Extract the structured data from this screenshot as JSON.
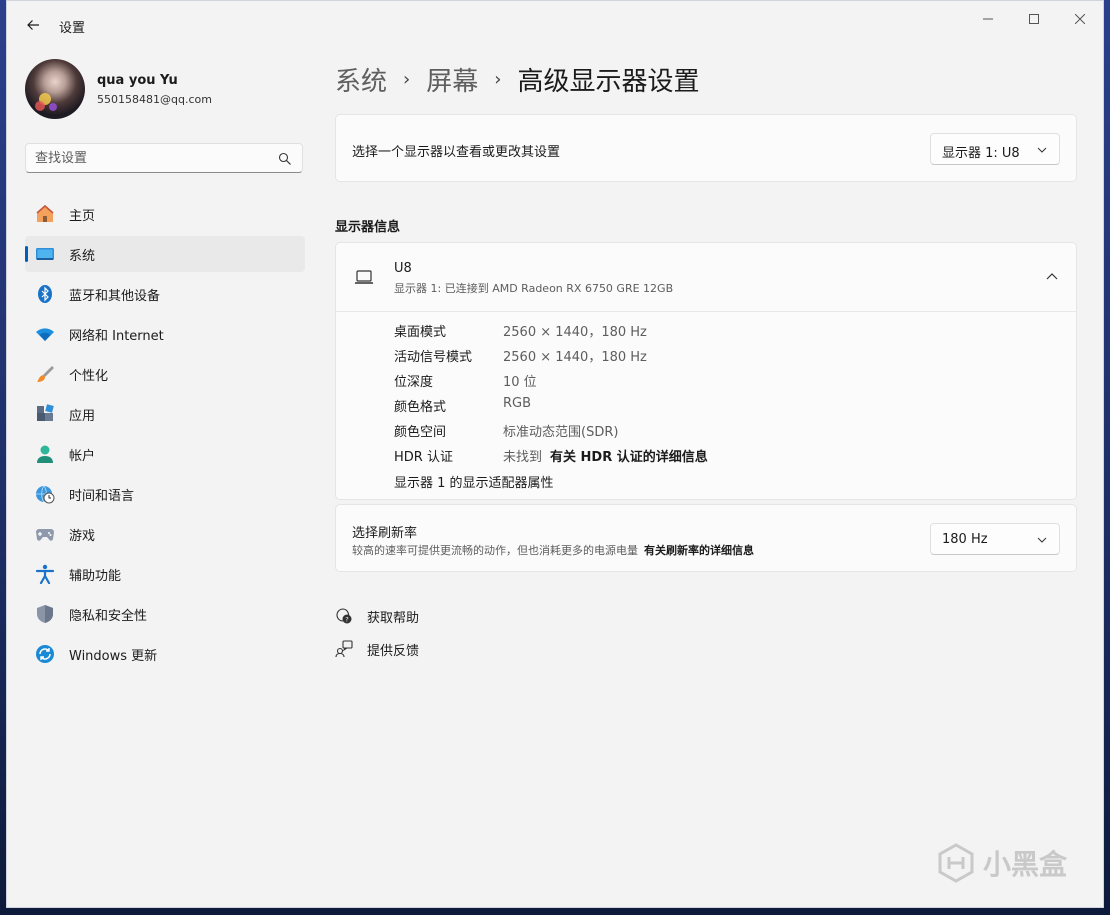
{
  "window": {
    "title": "设置",
    "controls": {
      "minimize": "minimize-icon",
      "maximize": "maximize-icon",
      "close": "close-icon"
    }
  },
  "user": {
    "name": "qua you Yu",
    "email": "550158481@qq.com"
  },
  "search": {
    "placeholder": "查找设置"
  },
  "sidebar": {
    "items": [
      {
        "label": "主页",
        "icon": "home-icon",
        "selected": false
      },
      {
        "label": "系统",
        "icon": "system-icon",
        "selected": true
      },
      {
        "label": "蓝牙和其他设备",
        "icon": "bluetooth-icon",
        "selected": false
      },
      {
        "label": "网络和 Internet",
        "icon": "wifi-icon",
        "selected": false
      },
      {
        "label": "个性化",
        "icon": "brush-icon",
        "selected": false
      },
      {
        "label": "应用",
        "icon": "apps-icon",
        "selected": false
      },
      {
        "label": "帐户",
        "icon": "account-icon",
        "selected": false
      },
      {
        "label": "时间和语言",
        "icon": "globe-clock-icon",
        "selected": false
      },
      {
        "label": "游戏",
        "icon": "gamepad-icon",
        "selected": false
      },
      {
        "label": "辅助功能",
        "icon": "accessibility-icon",
        "selected": false
      },
      {
        "label": "隐私和安全性",
        "icon": "shield-icon",
        "selected": false
      },
      {
        "label": "Windows 更新",
        "icon": "update-icon",
        "selected": false
      }
    ]
  },
  "breadcrumb": {
    "items": [
      "系统",
      "屏幕",
      "高级显示器设置"
    ],
    "separator": "›"
  },
  "display_select": {
    "label": "选择一个显示器以查看或更改其设置",
    "value": "显示器 1: U8"
  },
  "display_info": {
    "section_title": "显示器信息",
    "name": "U8",
    "description": "显示器 1: 已连接到 AMD Radeon RX 6750 GRE 12GB",
    "properties": [
      {
        "key": "桌面模式",
        "value": "2560 × 1440，180 Hz"
      },
      {
        "key": "活动信号模式",
        "value": "2560 × 1440，180 Hz"
      },
      {
        "key": "位深度",
        "value": "10 位"
      },
      {
        "key": "颜色格式",
        "value": "RGB"
      },
      {
        "key": "颜色空间",
        "value": "标准动态范围(SDR)"
      },
      {
        "key": "HDR 认证",
        "value": "未找到"
      }
    ],
    "hdr_link": "有关 HDR 认证的详细信息",
    "adapter_link": "显示器 1 的显示适配器属性"
  },
  "refresh_rate": {
    "title": "选择刷新率",
    "description": "较高的速率可提供更流畅的动作，但也消耗更多的电源电量",
    "link": "有关刷新率的详细信息",
    "value": "180 Hz"
  },
  "help": {
    "get_help": "获取帮助",
    "feedback": "提供反馈"
  },
  "watermark": {
    "text": "小黑盒"
  },
  "colors": {
    "accent": "#005fb8",
    "background": "#f3f3f3",
    "card": "#fbfbfb"
  }
}
